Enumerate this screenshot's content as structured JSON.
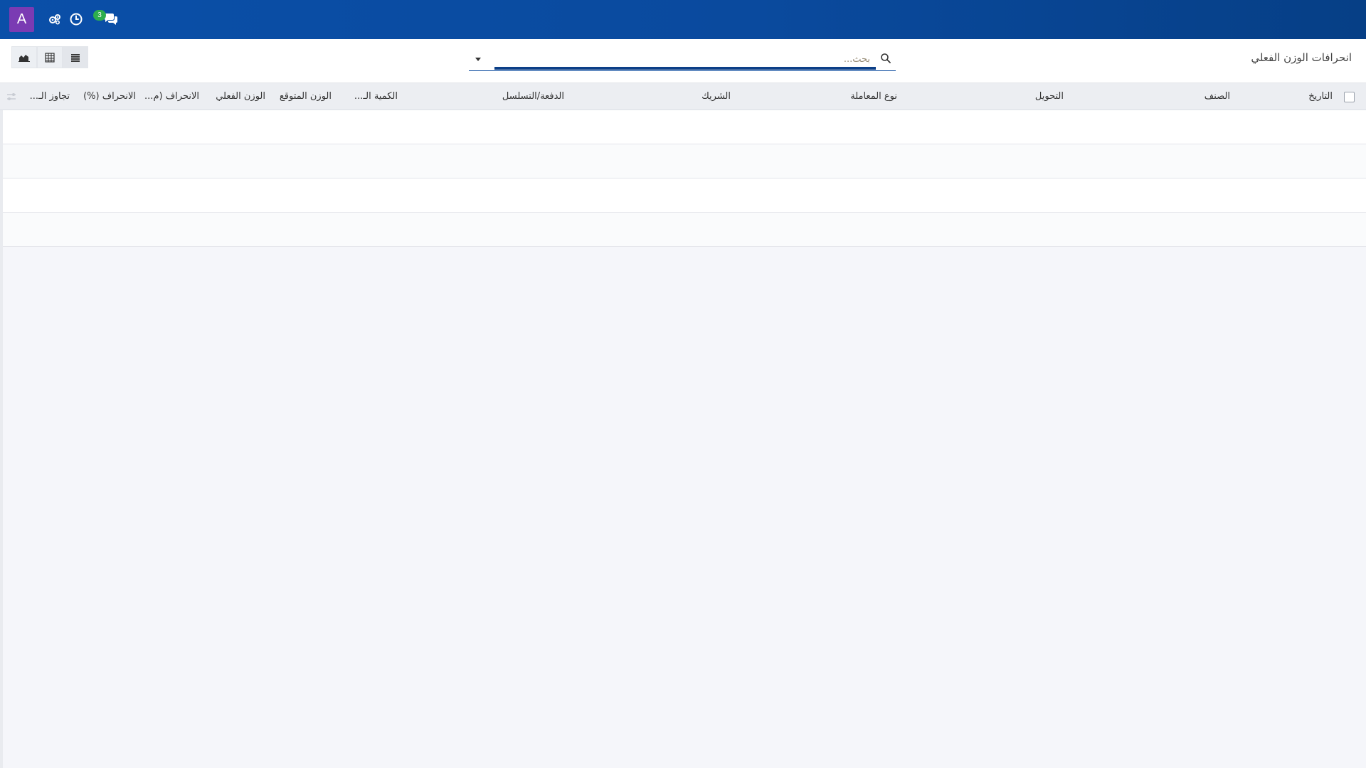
{
  "navbar": {
    "avatar_letter": "A",
    "icons": [
      "users-gear-icon",
      "clock-icon",
      "chat-icon"
    ],
    "message_count": "3",
    "color": "#0a4a9e"
  },
  "control_panel": {
    "breadcrumb": "انحرافات الوزن الفعلي",
    "search_placeholder": "بحث...",
    "view_buttons": [
      "list-view",
      "pivot-view",
      "graph-view"
    ]
  },
  "table": {
    "columns": [
      "التاريخ",
      "الصنف",
      "التحويل",
      "نوع المعاملة",
      "الشريك",
      "الدفعة/التسلسل",
      "الكمية الـ...",
      "الوزن المتوقع",
      "الوزن الفعلي",
      "الانحراف (م...",
      "الانحراف (%)",
      "تجاوز الـ..."
    ],
    "empty_rows": 4
  }
}
